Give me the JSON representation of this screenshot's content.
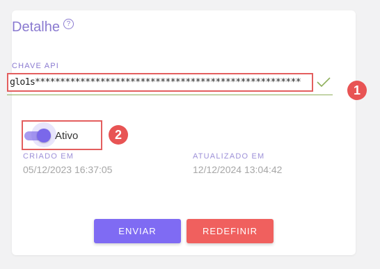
{
  "card": {
    "title": "Detalhe",
    "help_icon_glyph": "?",
    "api_key": {
      "label": "CHAVE API",
      "value": "glo1s*****************************************************"
    },
    "active_toggle": {
      "label": "Ativo",
      "checked": true
    },
    "created": {
      "label": "CRIADO EM",
      "value": "05/12/2023 16:37:05"
    },
    "updated": {
      "label": "ATUALIZADO EM",
      "value": "12/12/2024 13:04:42"
    },
    "buttons": {
      "send": "ENVIAR",
      "reset": "REDEFINIR"
    }
  },
  "markers": [
    "1",
    "2"
  ],
  "colors": {
    "accent": "#7f6bf3",
    "danger": "#f0605e",
    "highlight": "#e35e5e",
    "valid": "#8fb05c",
    "label": "#8a7ad0"
  }
}
